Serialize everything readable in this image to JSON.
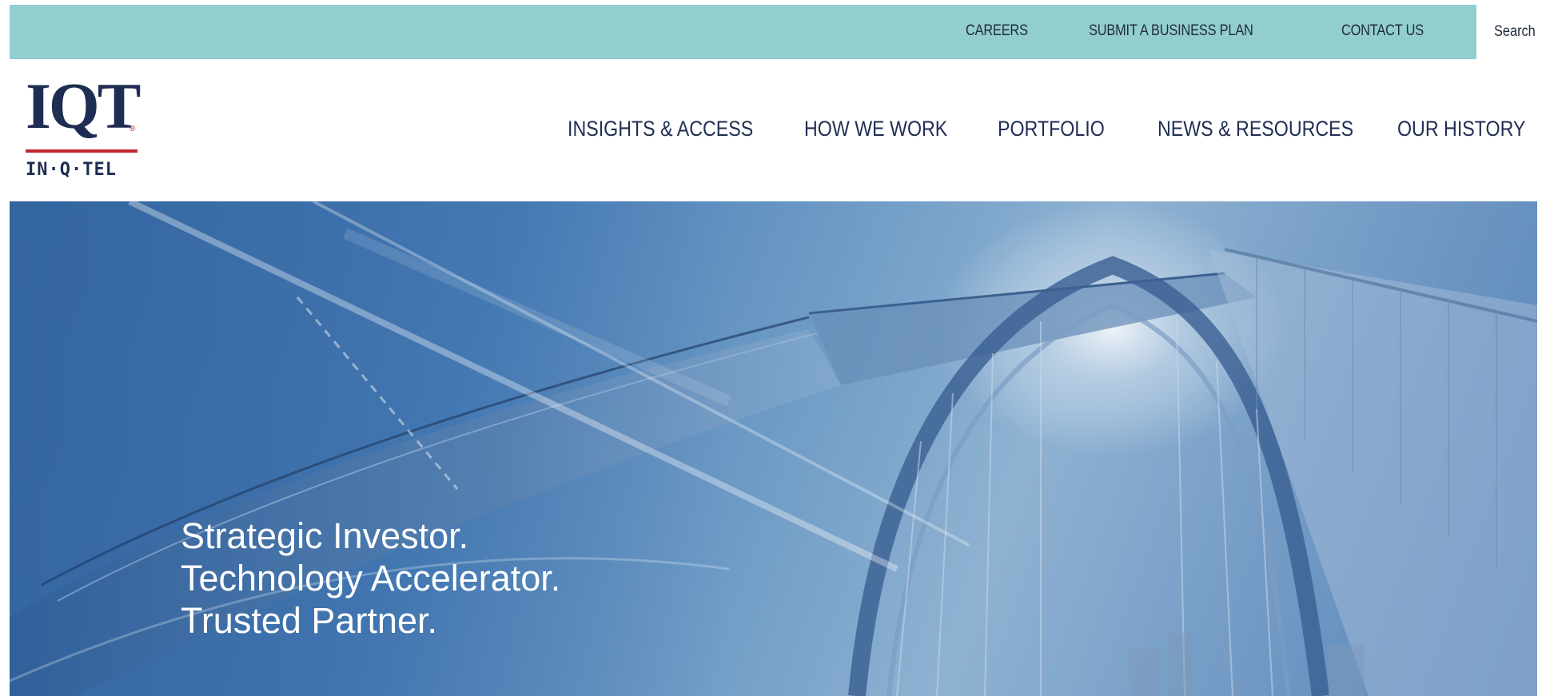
{
  "utility_nav": {
    "careers": "CAREERS",
    "submit_business_plan": "SUBMIT A BUSINESS PLAN",
    "contact_us": "CONTACT US",
    "search_placeholder": "Search"
  },
  "logo": {
    "main": "IQT",
    "registered": "®",
    "sub": "IN·Q·TEL"
  },
  "main_nav": {
    "insights_access": "INSIGHTS & ACCESS",
    "how_we_work": "HOW WE WORK",
    "portfolio": "PORTFOLIO",
    "news_resources": "NEWS & RESOURCES",
    "our_history": "OUR HISTORY"
  },
  "hero": {
    "line1": "Strategic Investor.",
    "line2": "Technology Accelerator.",
    "line3": "Trusted Partner."
  },
  "colors": {
    "utility_bar": "#93cece",
    "navy": "#1f2d52",
    "logo_red": "#c0272d",
    "hero_blue": "#4a7fb8"
  }
}
